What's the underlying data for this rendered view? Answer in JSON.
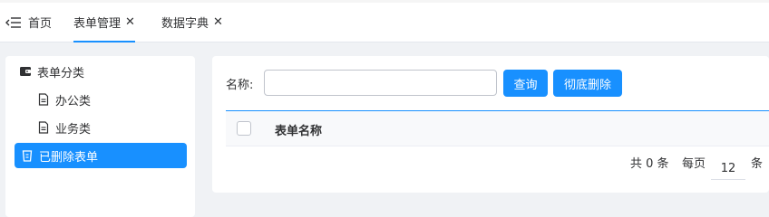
{
  "tabs": {
    "home_label": "首页",
    "form_mgmt_label": "表单管理",
    "dict_label": "数据字典",
    "close_glyph": "✕"
  },
  "sidebar": {
    "root_label": "表单分类",
    "items": [
      {
        "label": "办公类"
      },
      {
        "label": "业务类"
      }
    ],
    "deleted_label": "已删除表单"
  },
  "search": {
    "label": "名称:",
    "value": "",
    "placeholder": "",
    "query_button": "查询",
    "purge_button": "彻底删除"
  },
  "table": {
    "columns": [
      "表单名称"
    ],
    "rows": []
  },
  "pagination": {
    "total_text": "共 0 条",
    "per_page_label": "每页",
    "per_page_value": "12",
    "per_page_unit": "条"
  },
  "colors": {
    "accent": "#1890ff",
    "selected_bg": "#1890ff",
    "page_bg": "#f0f2f5"
  },
  "icons": {
    "home": "back-arrow-icon",
    "category_root": "wallet-icon",
    "category_item": "document-icon",
    "deleted": "trash-icon"
  }
}
